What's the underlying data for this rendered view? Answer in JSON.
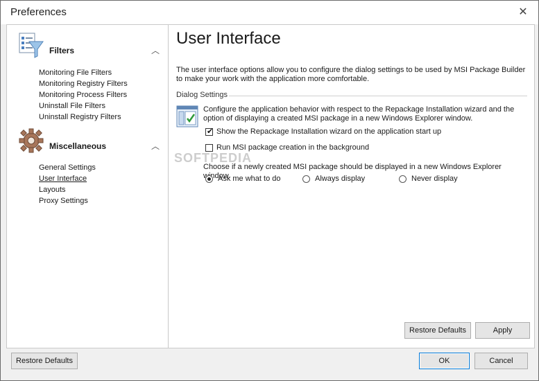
{
  "window": {
    "title": "Preferences",
    "close_glyph": "✕"
  },
  "sidebar": {
    "groups": [
      {
        "title": "Filters",
        "icon": "filter-checklist-icon",
        "items": [
          {
            "label": "Monitoring File Filters"
          },
          {
            "label": "Monitoring Registry Filters"
          },
          {
            "label": "Monitoring Process Filters"
          },
          {
            "label": "Uninstall File Filters"
          },
          {
            "label": "Uninstall Registry Filters"
          }
        ]
      },
      {
        "title": "Miscellaneous",
        "icon": "gear-icon",
        "items": [
          {
            "label": "General Settings"
          },
          {
            "label": "User Interface",
            "selected": true
          },
          {
            "label": "Layouts"
          },
          {
            "label": "Proxy Settings"
          }
        ]
      }
    ]
  },
  "main": {
    "heading": "User Interface",
    "description": "The user interface options allow you to configure the dialog settings to be used by MSI Package Builder to make your work with the application more comfortable.",
    "section_label": "Dialog Settings",
    "dialog_text": "Configure the application behavior with respect to the Repackage Installation wizard and the option of displaying a created MSI package in a new Windows Explorer window.",
    "checkboxes": [
      {
        "label": "Show the Repackage Installation wizard on the application start up",
        "checked": true
      },
      {
        "label": "Run MSI package creation in the background",
        "checked": false
      }
    ],
    "explorer_prompt": "Choose if a newly created MSI package should be displayed in a new Windows Explorer window.",
    "radios": [
      {
        "label": "Ask me what to do",
        "selected": true
      },
      {
        "label": "Always display",
        "selected": false
      },
      {
        "label": "Never display",
        "selected": false
      }
    ],
    "restore_defaults": "Restore Defaults",
    "apply": "Apply"
  },
  "footer": {
    "restore_defaults": "Restore Defaults",
    "ok": "OK",
    "cancel": "Cancel"
  },
  "watermark": "SOFTPEDIA",
  "colors": {
    "accent": "#0078d7",
    "border": "#c9c9c9",
    "background": "#f0f0f0"
  }
}
